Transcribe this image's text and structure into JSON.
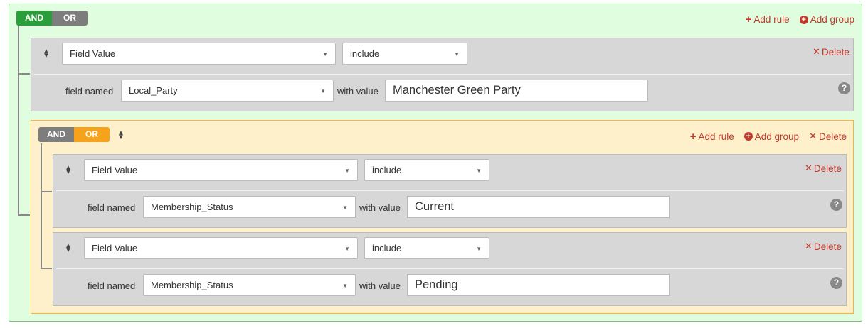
{
  "root": {
    "and_label": "AND",
    "or_label": "OR",
    "add_rule_label": "Add rule",
    "add_group_label": "Add group"
  },
  "rule1": {
    "type_value": "Field Value",
    "operator_value": "include",
    "delete_label": "Delete",
    "field_named_label": "field named",
    "field_value": "Local_Party",
    "with_value_label": "with value",
    "value": "Manchester Green Party"
  },
  "group2": {
    "and_label": "AND",
    "or_label": "OR",
    "add_rule_label": "Add rule",
    "add_group_label": "Add group",
    "delete_label": "Delete"
  },
  "rule2": {
    "type_value": "Field Value",
    "operator_value": "include",
    "delete_label": "Delete",
    "field_named_label": "field named",
    "field_value": "Membership_Status",
    "with_value_label": "with value",
    "value": "Current"
  },
  "rule3": {
    "type_value": "Field Value",
    "operator_value": "include",
    "delete_label": "Delete",
    "field_named_label": "field named",
    "field_value": "Membership_Status",
    "with_value_label": "with value",
    "value": "Pending"
  },
  "icons": {
    "plus": "+",
    "circle_plus": "+",
    "cross": "✕",
    "help": "?",
    "caret": "▼",
    "drag": "⬍"
  },
  "colors": {
    "root_bg": "#e0fde0",
    "nested_bg": "#fff0cc",
    "and_active": "#2a9e3a",
    "or_active": "#f7a21b",
    "action_red": "#c0392b"
  }
}
